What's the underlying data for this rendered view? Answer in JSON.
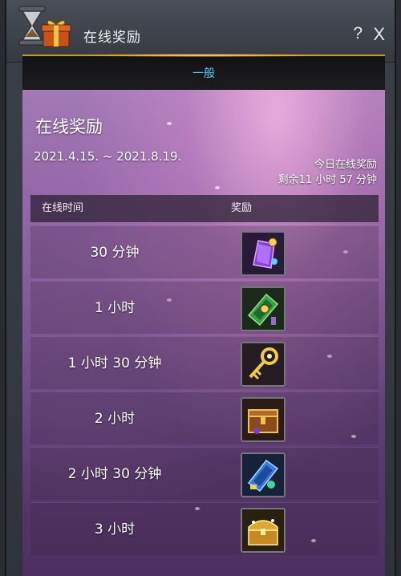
{
  "window": {
    "title": "在线奖励",
    "help_label": "?",
    "close_label": "X"
  },
  "tabs": [
    {
      "label": "一般",
      "active": true
    }
  ],
  "event": {
    "title": "在线奖励",
    "date_range": "2021.4.15. ~ 2021.8.19.",
    "today_label": "今日在线奖励",
    "remaining": "剩余11 小时 57 分钟"
  },
  "table": {
    "headers": {
      "time": "在线时间",
      "reward": "奖励"
    },
    "rows": [
      {
        "time": "30 分钟",
        "reward_icon": "purple-gem-pouch-icon"
      },
      {
        "time": "1 小时",
        "reward_icon": "green-scroll-icon"
      },
      {
        "time": "1 小时 30 分钟",
        "reward_icon": "golden-key-icon"
      },
      {
        "time": "2 小时",
        "reward_icon": "treasure-crate-icon"
      },
      {
        "time": "2 小时 30 分钟",
        "reward_icon": "blue-scroll-icon"
      },
      {
        "time": "3 小时",
        "reward_icon": "golden-chest-icon"
      }
    ]
  },
  "colors": {
    "tab_active": "#4fd0ff",
    "tab_border": "#c79a2a",
    "background_top": "#a07ab2",
    "background_bottom": "#4c2f60"
  }
}
